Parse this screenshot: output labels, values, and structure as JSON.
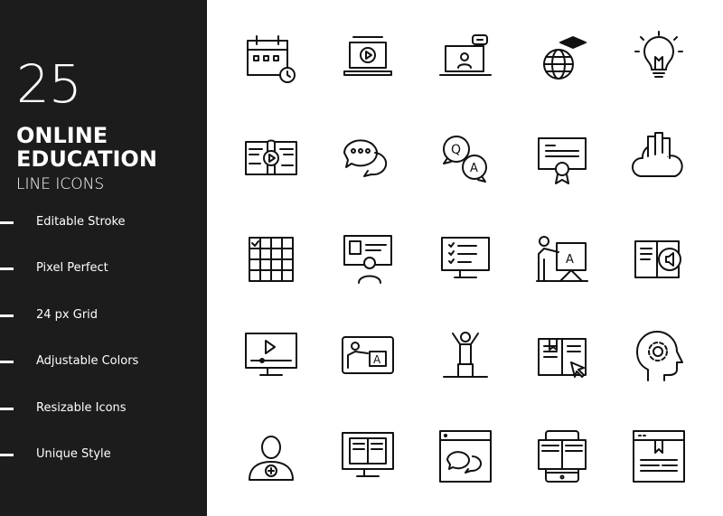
{
  "panel": {
    "count": "25",
    "title_line1": "ONLINE",
    "title_line2": "EDUCATION",
    "subtitle": "LINE ICONS",
    "background": "#1c1c1c"
  },
  "features": [
    "Editable Stroke",
    "Pixel Perfect",
    "24 px Grid",
    "Adjustable Colors",
    "Resizable Icons",
    "Unique Style"
  ],
  "icons": [
    "calendar-clock-icon",
    "laptop-video-icon",
    "laptop-video-call-icon",
    "globe-graduation-cap-icon",
    "lightbulb-icon",
    "book-video-icon",
    "chat-bubbles-icon",
    "question-answer-icon",
    "certificate-icon",
    "cloud-library-icon",
    "schedule-grid-icon",
    "video-lecture-icon",
    "monitor-checklist-icon",
    "teacher-board-icon",
    "audio-book-icon",
    "monitor-video-player-icon",
    "online-teacher-icon",
    "achievement-podium-icon",
    "ebook-click-icon",
    "mind-gear-icon",
    "add-student-icon",
    "monitor-book-icon",
    "browser-chat-icon",
    "mobile-book-icon",
    "web-bookmark-page-icon"
  ]
}
